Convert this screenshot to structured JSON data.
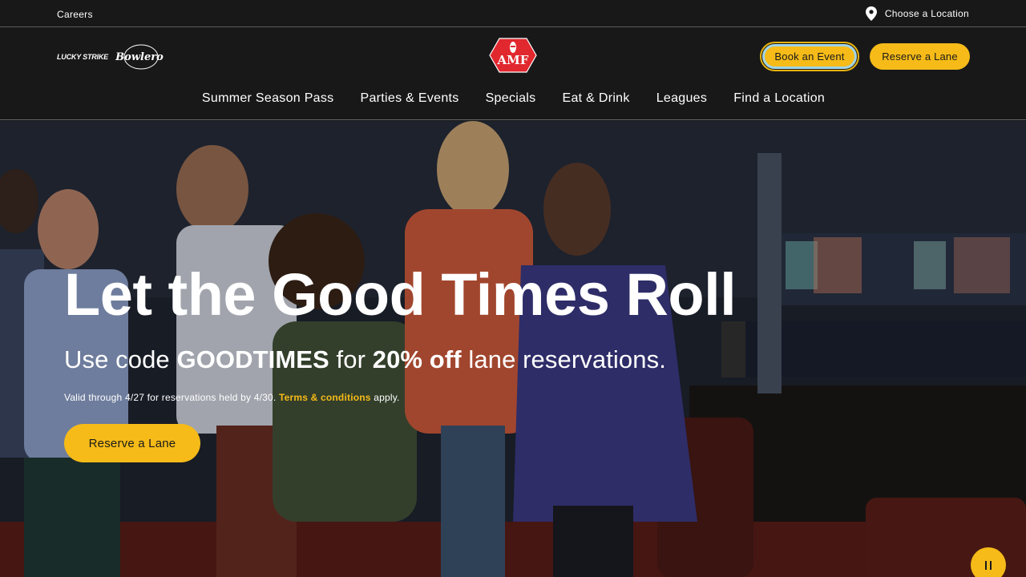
{
  "utility": {
    "careers_label": "Careers",
    "location_label": "Choose a Location"
  },
  "header": {
    "partner_logo_1": "LUCKY STRIKE",
    "partner_logo_2": "Bowlero",
    "brand_logo": "AMF",
    "book_event_label": "Book an Event",
    "reserve_lane_label": "Reserve a Lane"
  },
  "nav": {
    "items": [
      {
        "label": "Summer Season Pass"
      },
      {
        "label": "Parties & Events"
      },
      {
        "label": "Specials"
      },
      {
        "label": "Eat & Drink"
      },
      {
        "label": "Leagues"
      },
      {
        "label": "Find a Location"
      }
    ]
  },
  "hero": {
    "title": "Let the Good Times Roll",
    "sub_prefix": "Use code ",
    "sub_code": "GOODTIMES",
    "sub_mid": " for ",
    "sub_discount": "20% off",
    "sub_suffix": " lane reservations.",
    "fine_prefix": "Valid through 4/27 for reservations held by 4/30. ",
    "fine_link": "Terms & conditions",
    "fine_suffix": " apply.",
    "cta_label": "Reserve a Lane"
  },
  "colors": {
    "accent": "#f6bb18",
    "background": "#181818",
    "brand_red": "#e0282e"
  },
  "icons": {
    "location": "map-pin-icon",
    "pause": "pause-icon"
  }
}
